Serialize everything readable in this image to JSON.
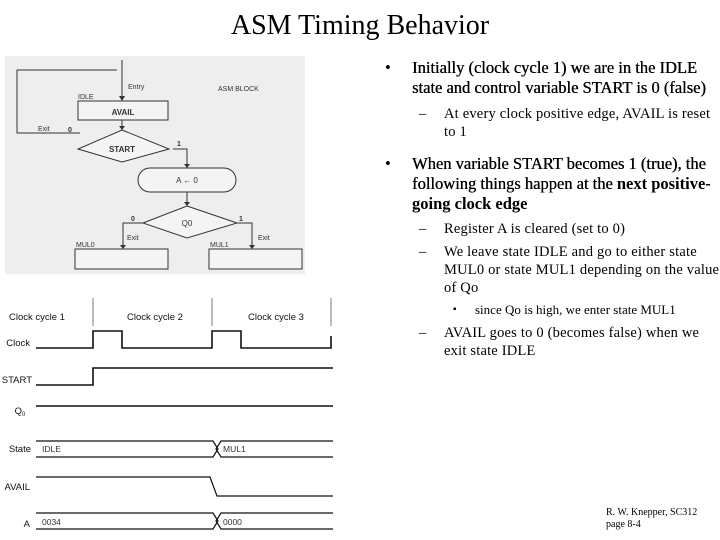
{
  "slide": {
    "title": "ASM Timing Behavior",
    "footer": {
      "author_line": "R. W. Knepper, SC312",
      "page_line": "page 8-4"
    }
  },
  "asm_chart": {
    "block_label": "ASM BLOCK",
    "entry_label": "Entry",
    "states": {
      "idle": {
        "name": "IDLE",
        "output": "AVAIL"
      },
      "mul0": {
        "name": "MUL0",
        "output": ""
      },
      "mul1": {
        "name": "MUL1",
        "output": ""
      }
    },
    "decisions": {
      "start": {
        "label": "START",
        "false_label": "0",
        "true_label": "1",
        "exit_label": "Exit"
      },
      "q0": {
        "label": "Q0",
        "false_label": "0",
        "true_label": "1",
        "exit_left": "Exit",
        "exit_right": "Exit"
      }
    },
    "conditional_output": "A ← 0"
  },
  "timing_diagram": {
    "cycle_labels": [
      "Clock cycle 1",
      "Clock cycle 2",
      "Clock cycle 3"
    ],
    "signals": [
      {
        "name": "Clock",
        "kind": "clock"
      },
      {
        "name": "START",
        "kind": "binary",
        "values": [
          0,
          1,
          1
        ]
      },
      {
        "name": "Q0",
        "kind": "binary",
        "values": [
          1,
          1,
          1
        ]
      },
      {
        "name": "State",
        "kind": "bus",
        "values": [
          "IDLE",
          "MUL1"
        ]
      },
      {
        "name": "AVAIL",
        "kind": "binary",
        "values": [
          1,
          1,
          0
        ]
      },
      {
        "name": "A",
        "kind": "bus",
        "values": [
          "0034",
          "0000"
        ]
      }
    ]
  },
  "bullets": [
    {
      "text": "Initially (clock cycle 1) we are in the IDLE state and control variable START is 0 (false)",
      "sub": [
        {
          "text": "At every clock positive edge, AVAIL is reset to 1"
        }
      ]
    },
    {
      "text": "When variable START becomes 1 (true), the following things happen at the ",
      "emphasis": "next positive-going clock edge",
      "sub": [
        {
          "text": "Register A is cleared (set to 0)"
        },
        {
          "text": "We leave state IDLE and go to either state MUL0 or state MUL1 depending on the value of Qo",
          "sub": [
            {
              "text": "since Qo is high, we enter state MUL1"
            }
          ]
        },
        {
          "text": "AVAIL goes to 0 (becomes false) when we exit state IDLE"
        }
      ]
    }
  ],
  "markers": {
    "bullet": "•",
    "dash": "–",
    "square": "▪"
  }
}
